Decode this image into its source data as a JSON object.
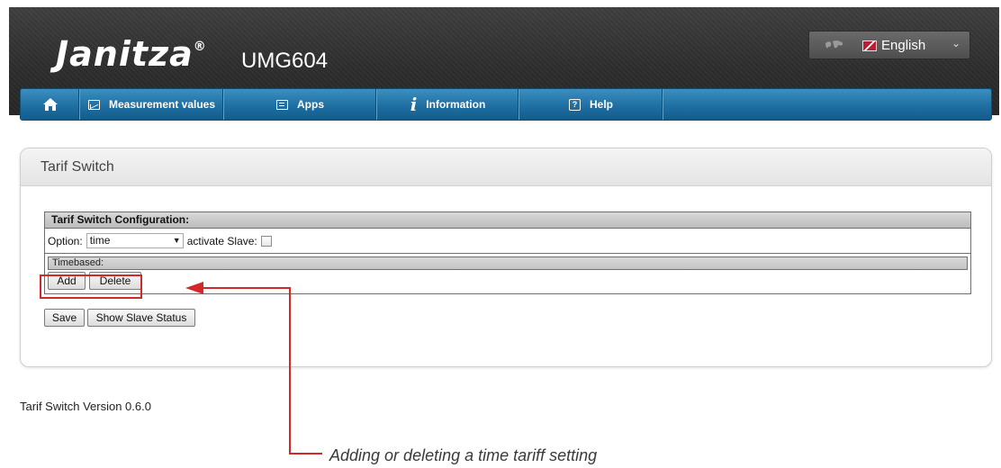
{
  "header": {
    "logo": "Janitza",
    "logo_reg": "®",
    "model": "UMG604",
    "language": "English"
  },
  "nav": {
    "items": [
      {
        "label": "Measurement values"
      },
      {
        "label": "Apps"
      },
      {
        "label": "Information"
      },
      {
        "label": "Help"
      }
    ]
  },
  "panel": {
    "title": "Tarif Switch",
    "config_title": "Tarif Switch Configuration:",
    "option_label": "Option:",
    "option_value": "time",
    "slave_label": "activate Slave:",
    "slave_checked": false,
    "timebased_label": "Timebased:",
    "add_label": "Add",
    "delete_label": "Delete",
    "save_label": "Save",
    "slave_status_label": "Show Slave Status"
  },
  "footer": {
    "version": "Tarif Switch Version 0.6.0"
  },
  "callout": {
    "text": "Adding or deleting a time tariff setting"
  },
  "colors": {
    "nav_blue": "#1f6fa3",
    "callout_red": "#d42828",
    "header_dark": "#2e2e2e"
  }
}
